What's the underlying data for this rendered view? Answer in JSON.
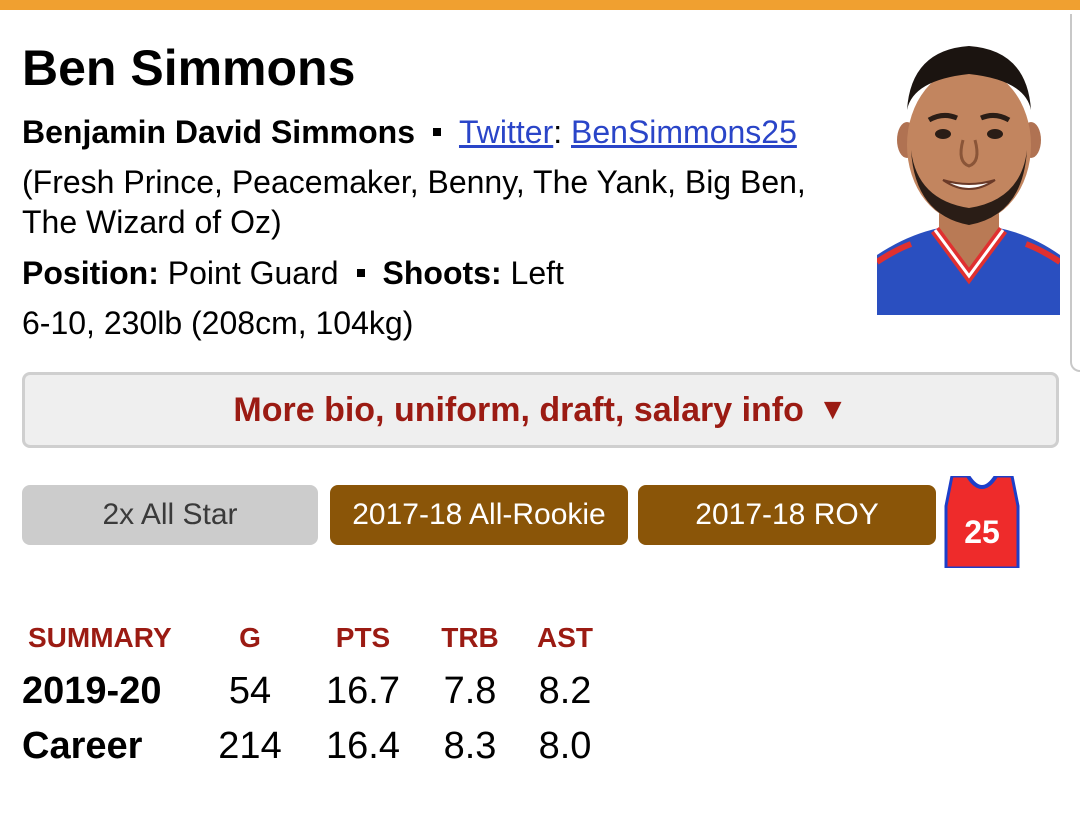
{
  "colors": {
    "accent_bar": "#f0a030",
    "stat_header": "#9b1b13",
    "award_brown": "#8a5508",
    "award_gray": "#cccccc",
    "link": "#2a45c8",
    "jersey_red": "#ee2b2b",
    "jersey_blue": "#1d3ec8"
  },
  "player": {
    "name": "Ben Simmons",
    "full_name": "Benjamin David Simmons",
    "twitter_label": "Twitter",
    "twitter_colon": ":",
    "twitter_handle": "BenSimmons25",
    "nicknames_line1": "(Fresh Prince, Peacemaker, Benny, The Yank, Big Ben,",
    "nicknames_line2": "The Wizard of Oz)",
    "position_label": "Position:",
    "position_value": "Point Guard",
    "shoots_label": "Shoots:",
    "shoots_value": "Left",
    "measurements": "6-10, 230lb (208cm, 104kg)",
    "headshot_icon": "player-headshot-photo"
  },
  "more_info_button": {
    "label": "More bio, uniform, draft, salary info",
    "arrow": "▼"
  },
  "awards": [
    {
      "label": "2x All Star",
      "style": "gray"
    },
    {
      "label": "2017-18 All-Rookie",
      "style": "brown"
    },
    {
      "label": "2017-18 ROY",
      "style": "brown"
    }
  ],
  "jersey": {
    "number": "25",
    "icon": "jersey-icon"
  },
  "summary": {
    "headers": [
      "SUMMARY",
      "G",
      "PTS",
      "TRB",
      "AST"
    ],
    "rows": [
      {
        "label": "2019-20",
        "g": "54",
        "pts": "16.7",
        "trb": "7.8",
        "ast": "8.2"
      },
      {
        "label": "Career",
        "g": "214",
        "pts": "16.4",
        "trb": "8.3",
        "ast": "8.0"
      }
    ]
  }
}
